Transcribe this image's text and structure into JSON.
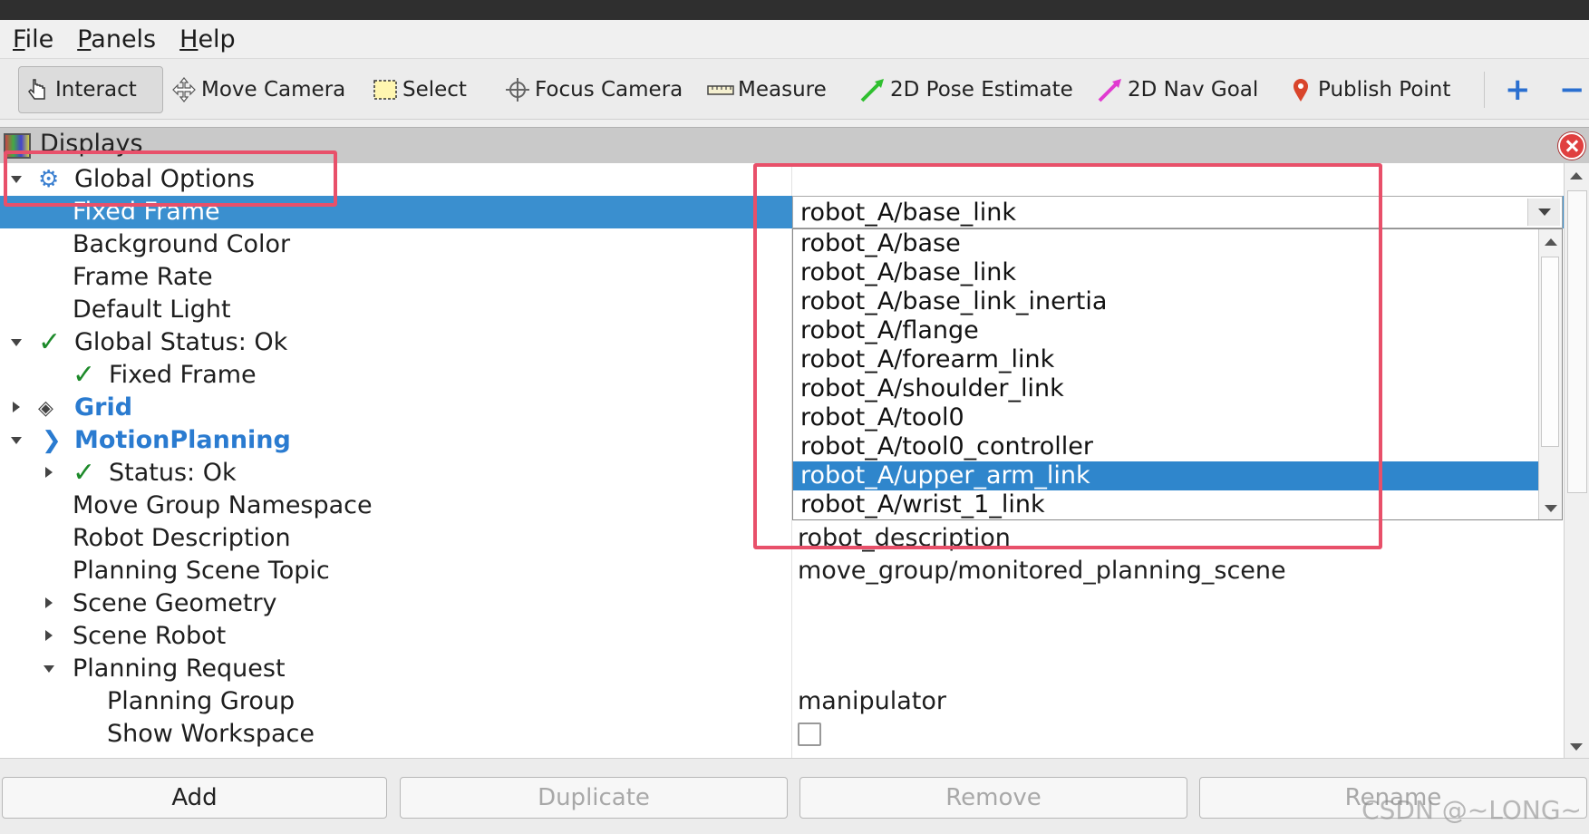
{
  "menu": [
    {
      "label_u": "F",
      "label_rest": "ile"
    },
    {
      "label_u": "P",
      "label_rest": "anels"
    },
    {
      "label_u": "H",
      "label_rest": "elp"
    }
  ],
  "toolbar": {
    "interact": "Interact",
    "move_camera": "Move Camera",
    "select": "Select",
    "focus_camera": "Focus Camera",
    "measure": "Measure",
    "pose_estimate": "2D Pose Estimate",
    "nav_goal": "2D Nav Goal",
    "publish_point": "Publish Point",
    "add_icon": "+",
    "remove_icon": "−"
  },
  "panel": {
    "title": "Displays"
  },
  "tree": {
    "global_options": "Global Options",
    "fixed_frame": "Fixed Frame",
    "background_color": "Background Color",
    "frame_rate": "Frame Rate",
    "default_light": "Default Light",
    "global_status": "Global Status: Ok",
    "status_fixed_frame": "Fixed Frame",
    "grid": "Grid",
    "motion_planning": "MotionPlanning",
    "status_ok": "Status: Ok",
    "move_group_namespace": "Move Group Namespace",
    "robot_description": "Robot Description",
    "planning_scene_topic": "Planning Scene Topic",
    "scene_geometry": "Scene Geometry",
    "scene_robot": "Scene Robot",
    "planning_request": "Planning Request",
    "planning_group": "Planning Group",
    "show_workspace": "Show Workspace"
  },
  "values": {
    "fixed_frame": "robot_A/base_link",
    "robot_description": "robot_description",
    "planning_scene_topic": "move_group/monitored_planning_scene",
    "planning_group": "manipulator"
  },
  "dropdown": {
    "options": [
      "robot_A/base",
      "robot_A/base_link",
      "robot_A/base_link_inertia",
      "robot_A/flange",
      "robot_A/forearm_link",
      "robot_A/shoulder_link",
      "robot_A/tool0",
      "robot_A/tool0_controller",
      "robot_A/upper_arm_link",
      "robot_A/wrist_1_link"
    ],
    "highlighted": "robot_A/upper_arm_link"
  },
  "buttons": {
    "add": "Add",
    "duplicate": "Duplicate",
    "remove": "Remove",
    "rename": "Rename"
  },
  "watermark": "CSDN @~LONG~",
  "colors": {
    "selection": "#3a8fcf",
    "highlight": "#2f86cc",
    "annotation": "#e8506a",
    "status_ok": "#1d8a2a",
    "link_blue": "#2a7bd0"
  }
}
